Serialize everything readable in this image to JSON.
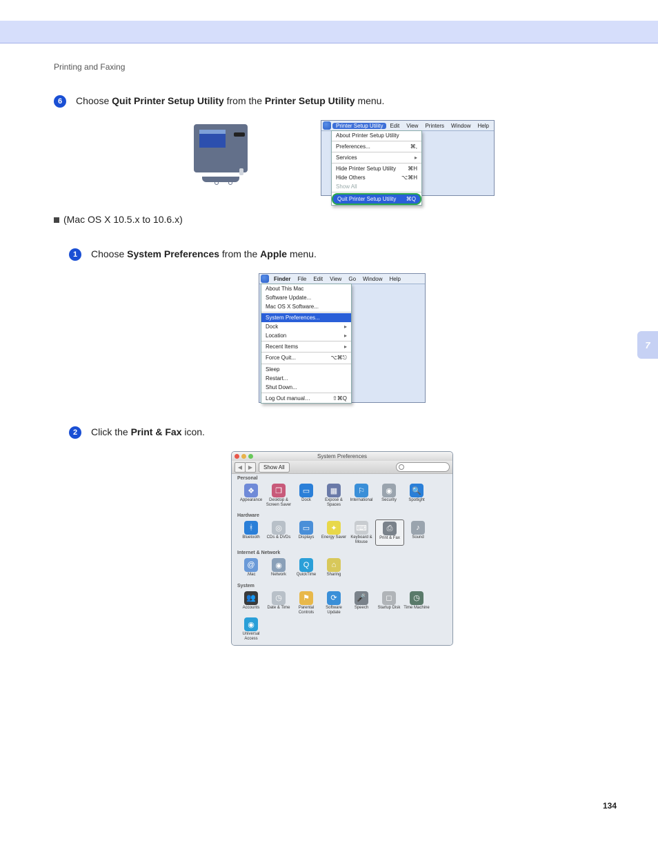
{
  "header": {
    "section": "Printing and Faxing"
  },
  "sideTab": "7",
  "step6": {
    "num": "6",
    "pre": "Choose ",
    "bold1": "Quit Printer Setup Utility",
    "mid": " from the ",
    "bold2": "Printer Setup Utility",
    "post": " menu."
  },
  "psuMenu": {
    "title": "Printer Setup Utility",
    "menus": [
      "Edit",
      "View",
      "Printers",
      "Window",
      "Help"
    ],
    "items": [
      {
        "label": "About Printer Setup Utility",
        "short": ""
      },
      {
        "label": "Preferences...",
        "short": "⌘,"
      },
      {
        "label": "Services",
        "short": "▸"
      },
      {
        "label": "Hide Printer Setup Utility",
        "short": "⌘H"
      },
      {
        "label": "Hide Others",
        "short": "⌥⌘H"
      },
      {
        "label": "Show All",
        "short": "",
        "disabled": true
      },
      {
        "label": "Quit Printer Setup Utility",
        "short": "⌘Q",
        "circled": true
      }
    ]
  },
  "bullet": "(Mac OS X 10.5.x to 10.6.x)",
  "step1": {
    "num": "1",
    "pre": "Choose ",
    "bold1": "System Preferences",
    "mid": " from the ",
    "bold2": "Apple",
    "post": " menu."
  },
  "appleMenu": {
    "title": "Finder",
    "menus": [
      "File",
      "Edit",
      "View",
      "Go",
      "Window",
      "Help"
    ],
    "groups": [
      [
        {
          "label": "About This Mac",
          "short": ""
        },
        {
          "label": "Software Update...",
          "short": ""
        },
        {
          "label": "Mac OS X Software...",
          "short": ""
        }
      ],
      [
        {
          "label": "System Preferences...",
          "short": "",
          "selected": true
        },
        {
          "label": "Dock",
          "short": "▸"
        },
        {
          "label": "Location",
          "short": "▸"
        }
      ],
      [
        {
          "label": "Recent Items",
          "short": "▸"
        }
      ],
      [
        {
          "label": "Force Quit...",
          "short": "⌥⌘⎋"
        }
      ],
      [
        {
          "label": "Sleep",
          "short": ""
        },
        {
          "label": "Restart...",
          "short": ""
        },
        {
          "label": "Shut Down...",
          "short": ""
        }
      ],
      [
        {
          "label": "Log Out manual…",
          "short": "⇧⌘Q"
        }
      ]
    ]
  },
  "step2": {
    "num": "2",
    "pre": "Click the ",
    "bold1": "Print & Fax",
    "post": " icon."
  },
  "sysprefs": {
    "title": "System Preferences",
    "showAll": "Show All",
    "cats": [
      {
        "name": "Personal",
        "icons": [
          {
            "lbl": "Appearance",
            "bg": "#6f8ad8",
            "g": "❖"
          },
          {
            "lbl": "Desktop & Screen Saver",
            "bg": "#c85a7a",
            "g": "❒"
          },
          {
            "lbl": "Dock",
            "bg": "#2a7fd8",
            "g": "▭"
          },
          {
            "lbl": "Exposé & Spaces",
            "bg": "#6a7aa8",
            "g": "▦"
          },
          {
            "lbl": "International",
            "bg": "#3a8fd8",
            "g": "⚐"
          },
          {
            "lbl": "Security",
            "bg": "#9aa4ae",
            "g": "◉"
          },
          {
            "lbl": "Spotlight",
            "bg": "#2a7fd8",
            "g": "🔍"
          }
        ]
      },
      {
        "name": "Hardware",
        "icons": [
          {
            "lbl": "Bluetooth",
            "bg": "#2a7fd8",
            "g": "ᚼ"
          },
          {
            "lbl": "CDs & DVDs",
            "bg": "#b8c0c8",
            "g": "◎"
          },
          {
            "lbl": "Displays",
            "bg": "#4a8fd8",
            "g": "▭"
          },
          {
            "lbl": "Energy Saver",
            "bg": "#e8d84a",
            "g": "✦"
          },
          {
            "lbl": "Keyboard & Mouse",
            "bg": "#c8ccd0",
            "g": "⌨"
          },
          {
            "lbl": "Print & Fax",
            "bg": "#7a828a",
            "g": "⎙",
            "boxed": true
          },
          {
            "lbl": "Sound",
            "bg": "#9aa4ae",
            "g": "♪"
          }
        ]
      },
      {
        "name": "Internet & Network",
        "icons": [
          {
            "lbl": ".Mac",
            "bg": "#6a9ad8",
            "g": "@"
          },
          {
            "lbl": "Network",
            "bg": "#8aa0b8",
            "g": "◉"
          },
          {
            "lbl": "QuickTime",
            "bg": "#2a9fd8",
            "g": "Q"
          },
          {
            "lbl": "Sharing",
            "bg": "#d8c85a",
            "g": "⌂"
          }
        ]
      },
      {
        "name": "System",
        "icons": [
          {
            "lbl": "Accounts",
            "bg": "#3a3a3a",
            "g": "👥"
          },
          {
            "lbl": "Date & Time",
            "bg": "#b8c0c8",
            "g": "◷"
          },
          {
            "lbl": "Parental Controls",
            "bg": "#e8b84a",
            "g": "⚑"
          },
          {
            "lbl": "Software Update",
            "bg": "#3a8fd8",
            "g": "⟳"
          },
          {
            "lbl": "Speech",
            "bg": "#7a828a",
            "g": "🎤"
          },
          {
            "lbl": "Startup Disk",
            "bg": "#b0b4b8",
            "g": "◻"
          },
          {
            "lbl": "Time Machine",
            "bg": "#5a7a6a",
            "g": "◷"
          },
          {
            "lbl": "Universal Access",
            "bg": "#2a9fd8",
            "g": "◉"
          }
        ]
      }
    ]
  },
  "pageNumber": "134"
}
